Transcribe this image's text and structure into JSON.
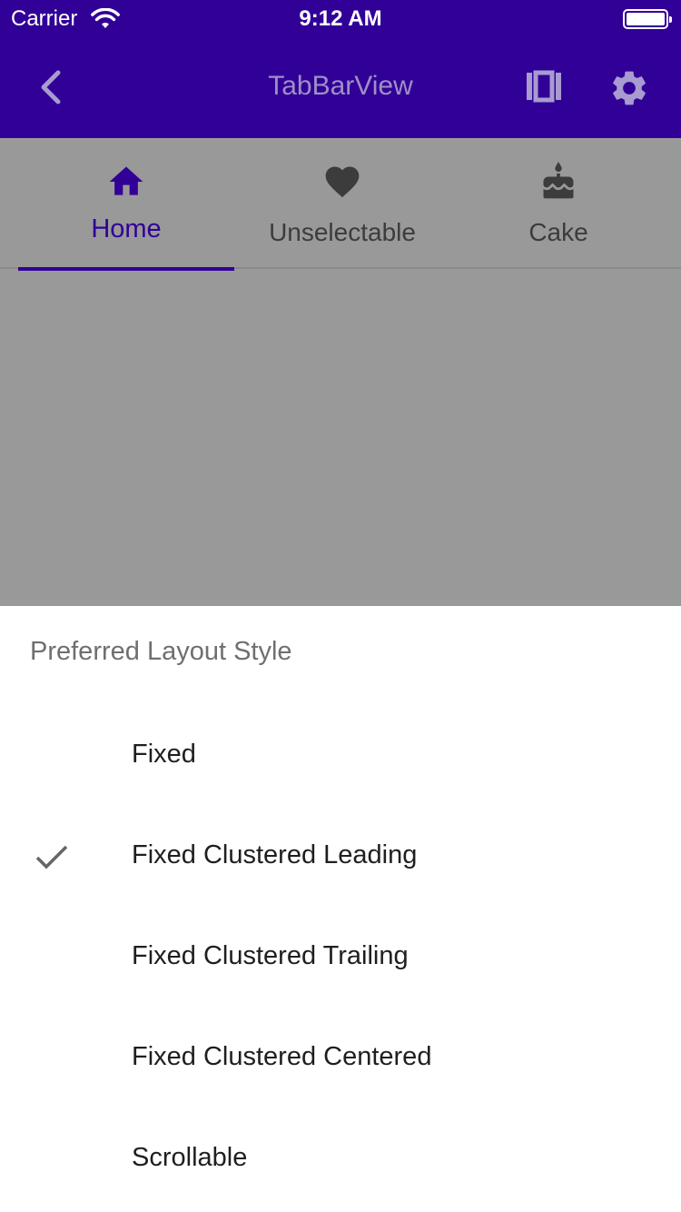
{
  "status_bar": {
    "carrier": "Carrier",
    "time": "9:12 AM",
    "icons": [
      "wifi-icon",
      "battery-icon"
    ]
  },
  "app_bar": {
    "title": "TabBarView",
    "background": "#310097",
    "actions": [
      "back-icon",
      "view-layout-icon",
      "settings-icon"
    ]
  },
  "tabs": [
    {
      "label": "Home",
      "icon": "home-icon",
      "selected": true
    },
    {
      "label": "Unselectable",
      "icon": "heart-icon",
      "selected": false
    },
    {
      "label": "Cake",
      "icon": "cake-icon",
      "selected": false
    }
  ],
  "sheet": {
    "title": "Preferred Layout Style",
    "options": [
      {
        "label": "Fixed",
        "checked": false
      },
      {
        "label": "Fixed Clustered Leading",
        "checked": true
      },
      {
        "label": "Fixed Clustered Trailing",
        "checked": false
      },
      {
        "label": "Fixed Clustered Centered",
        "checked": false
      },
      {
        "label": "Scrollable",
        "checked": false
      }
    ]
  },
  "colors": {
    "primary": "#310097",
    "scrim": "#999999",
    "tab_inactive": "#3c3c3c"
  }
}
